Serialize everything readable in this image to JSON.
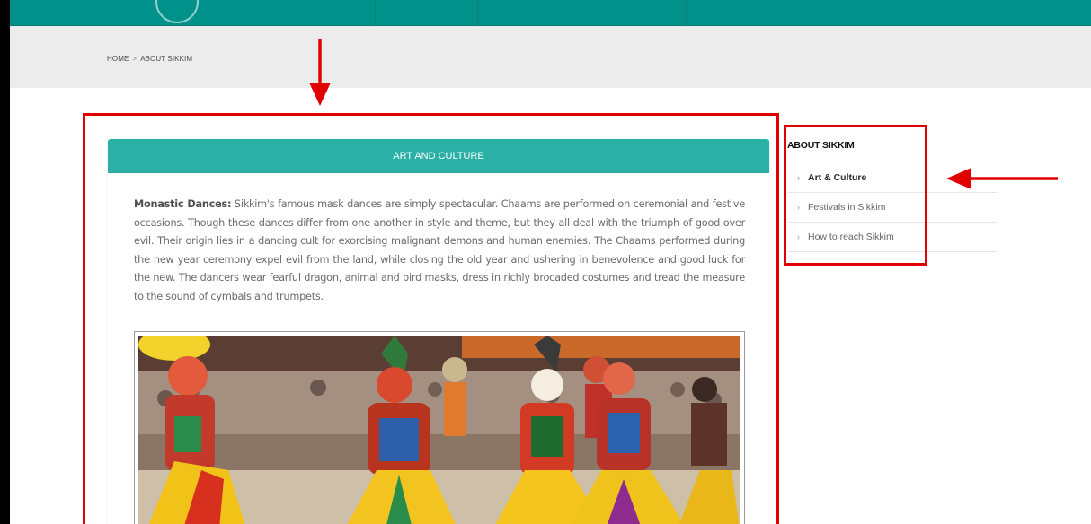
{
  "breadcrumb": {
    "home": "HOME",
    "separator": ">",
    "current": "ABOUT SIKKIM"
  },
  "content": {
    "header": "ART AND CULTURE",
    "paragraph_lead": "Monastic Dances:",
    "paragraph_text": " Sikkim's famous mask dances are simply spectacular. Chaams are performed on ceremonial and festive occasions. Though these dances differ from one another in style and theme, but they all deal with the triumph of good over evil. Their origin lies in a dancing cult for exorcising malignant demons and human enemies. The Chaams performed during the new year ceremony expel evil from the land, while closing the old year and ushering in benevolence and good luck for the new. The dancers wear fearful dragon, animal and bird masks, dress in richly brocaded costumes and tread the measure to the sound of cymbals and trumpets."
  },
  "sidebar": {
    "title": "ABOUT SIKKIM",
    "items": [
      {
        "label": "Art & Culture",
        "active": true
      },
      {
        "label": "Festivals in Sikkim",
        "active": false
      },
      {
        "label": "How to reach Sikkim",
        "active": false
      }
    ]
  },
  "colors": {
    "topbar": "#00928a",
    "header_bar": "#2bb0a6",
    "annotation": "#e00000"
  },
  "icons": [
    "chevron-right-icon",
    "arrow-down-icon",
    "arrow-left-icon"
  ]
}
